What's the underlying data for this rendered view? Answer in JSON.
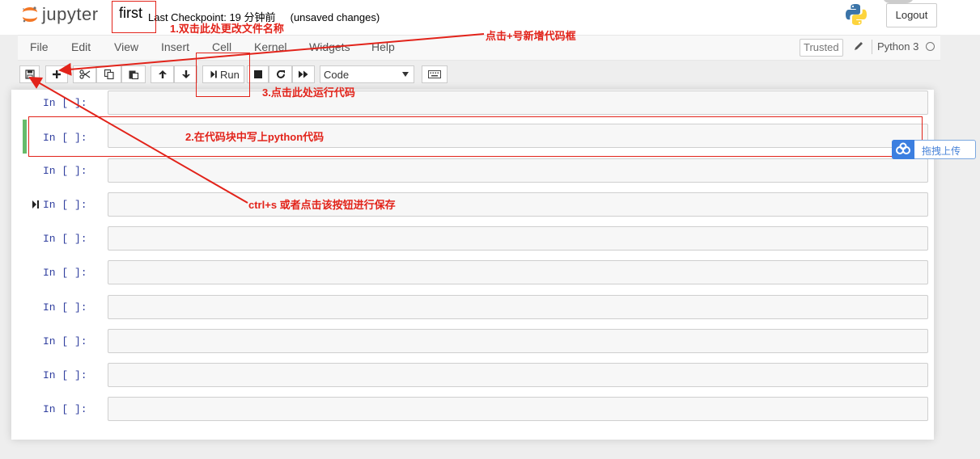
{
  "header": {
    "logo_text": "jupyter",
    "notebook_name": "first",
    "checkpoint_text": "Last Checkpoint: 19 分钟前",
    "unsaved_text": "(unsaved changes)",
    "logout_label": "Logout"
  },
  "menubar": {
    "items": [
      "File",
      "Edit",
      "View",
      "Insert",
      "Cell",
      "Kernel",
      "Widgets",
      "Help"
    ],
    "trusted_label": "Trusted",
    "kernel_name": "Python 3"
  },
  "toolbar": {
    "run_label": "Run",
    "cell_type": "Code",
    "buttons": [
      "save-icon",
      "plus-icon",
      "cut-icon",
      "copy-icon",
      "paste-icon",
      "arrow-up-icon",
      "arrow-down-icon",
      "run-icon",
      "stop-icon",
      "restart-icon",
      "fast-forward-icon",
      "keyboard-icon"
    ]
  },
  "cells": [
    {
      "prompt": "In [ ]:"
    },
    {
      "prompt": "In [ ]:"
    },
    {
      "prompt": "In [ ]:"
    },
    {
      "prompt": "In [ ]:"
    },
    {
      "prompt": "In [ ]:"
    },
    {
      "prompt": "In [ ]:"
    },
    {
      "prompt": "In [ ]:"
    },
    {
      "prompt": "In [ ]:"
    },
    {
      "prompt": "In [ ]:"
    },
    {
      "prompt": "In [ ]:"
    }
  ],
  "annotations": {
    "rename": "1.双击此处更改文件名称",
    "add_cell": "点击+号新增代码框",
    "run": "3.点击此处运行代码",
    "write_code": "2.在代码块中写上python代码",
    "save": "ctrl+s 或者点击该按钮进行保存",
    "color": "#e2231a"
  },
  "upload_widget": {
    "label": "拖拽上传"
  }
}
